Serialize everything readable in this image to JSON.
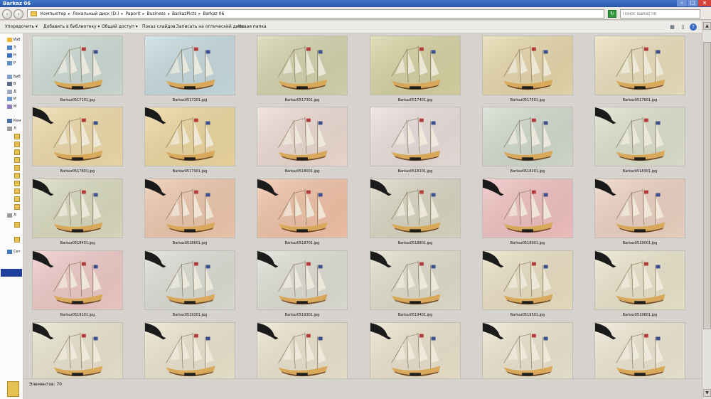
{
  "window": {
    "title": "Barkaz 06"
  },
  "address": {
    "crumbs": [
      "Компьютер",
      "Локальный диск (D:)",
      "Paporit",
      "Business",
      "BarkazPicts",
      "Barkaz 06"
    ],
    "separator": "▸"
  },
  "search": {
    "placeholder": "Поиск: Barkaz 06"
  },
  "toolbar": {
    "organize": "Упорядочить ▾",
    "add_to_library": "Добавить в библиотеку ▾",
    "share": "Общий доступ ▾",
    "slideshow": "Показ слайдов",
    "burn": "Записать на оптический диск",
    "new_folder": "Новая папка"
  },
  "sidebar": {
    "items": [
      {
        "label": "Изб",
        "icon": "star-icon"
      },
      {
        "label": "З",
        "icon": "download-icon"
      },
      {
        "label": "Н",
        "icon": "desktop-icon"
      },
      {
        "label": "Р",
        "icon": "recent-icon"
      },
      {
        "label": "Биб",
        "icon": "library-icon"
      },
      {
        "label": "В",
        "icon": "video-icon"
      },
      {
        "label": "Д",
        "icon": "documents-icon"
      },
      {
        "label": "И",
        "icon": "pictures-icon"
      },
      {
        "label": "М",
        "icon": "music-icon"
      },
      {
        "label": "Ком",
        "icon": "computer-icon"
      },
      {
        "label": "Л",
        "icon": "drive-icon"
      },
      {
        "label": "Л",
        "icon": "drive-icon"
      },
      {
        "label": "Сет",
        "icon": "network-icon"
      }
    ]
  },
  "files": [
    {
      "name": "Barkaz0517101.jpg",
      "tint": "#cfddd6"
    },
    {
      "name": "Barkaz0517201.jpg",
      "tint": "#c8dce0"
    },
    {
      "name": "Barkaz0517301.jpg",
      "tint": "#d5d5ae"
    },
    {
      "name": "Barkaz0517401.jpg",
      "tint": "#d8d3a3"
    },
    {
      "name": "Barkaz0517501.jpg",
      "tint": "#e8d9ac"
    },
    {
      "name": "Barkaz0517601.jpg",
      "tint": "#ece0bc"
    },
    {
      "name": "Barkaz0517801.jpg",
      "tint": "#f0dcaa"
    },
    {
      "name": "Barkaz0517901.jpg",
      "tint": "#efd9a0"
    },
    {
      "name": "Barkaz0518001.jpg",
      "tint": "#efdcd4"
    },
    {
      "name": "Barkaz0518101.jpg",
      "tint": "#ede0dd"
    },
    {
      "name": "Barkaz0518201.jpg",
      "tint": "#d4ddd0"
    },
    {
      "name": "Barkaz0518301.jpg",
      "tint": "#dfe2cd"
    },
    {
      "name": "Barkaz0518401.jpg",
      "tint": "#dbdcc0"
    },
    {
      "name": "Barkaz0518601.jpg",
      "tint": "#f0c9ae"
    },
    {
      "name": "Barkaz0518701.jpg",
      "tint": "#f3c3a7"
    },
    {
      "name": "Barkaz0518801.jpg",
      "tint": "#dbd7c3"
    },
    {
      "name": "Barkaz0518901.jpg",
      "tint": "#f3c2c2"
    },
    {
      "name": "Barkaz0519001.jpg",
      "tint": "#efd4c4"
    },
    {
      "name": "Barkaz0519101.jpg",
      "tint": "#f1cbc8"
    },
    {
      "name": "Barkaz0519201.jpg",
      "tint": "#dedfd6"
    },
    {
      "name": "Barkaz0519301.jpg",
      "tint": "#e0e0d6"
    },
    {
      "name": "Barkaz0519401.jpg",
      "tint": "#e2dfcd"
    },
    {
      "name": "Barkaz0519501.jpg",
      "tint": "#ece1c4"
    },
    {
      "name": "Barkaz0519601.jpg",
      "tint": "#ece6cc"
    },
    {
      "name": "",
      "tint": "#ebe6cf"
    },
    {
      "name": "",
      "tint": "#ede6cf"
    },
    {
      "name": "",
      "tint": "#ede5cf"
    },
    {
      "name": "",
      "tint": "#ede4cd"
    },
    {
      "name": "",
      "tint": "#ede6d0"
    },
    {
      "name": "",
      "tint": "#efe8d3"
    }
  ],
  "status": {
    "items_label": "Элементов: 70"
  }
}
